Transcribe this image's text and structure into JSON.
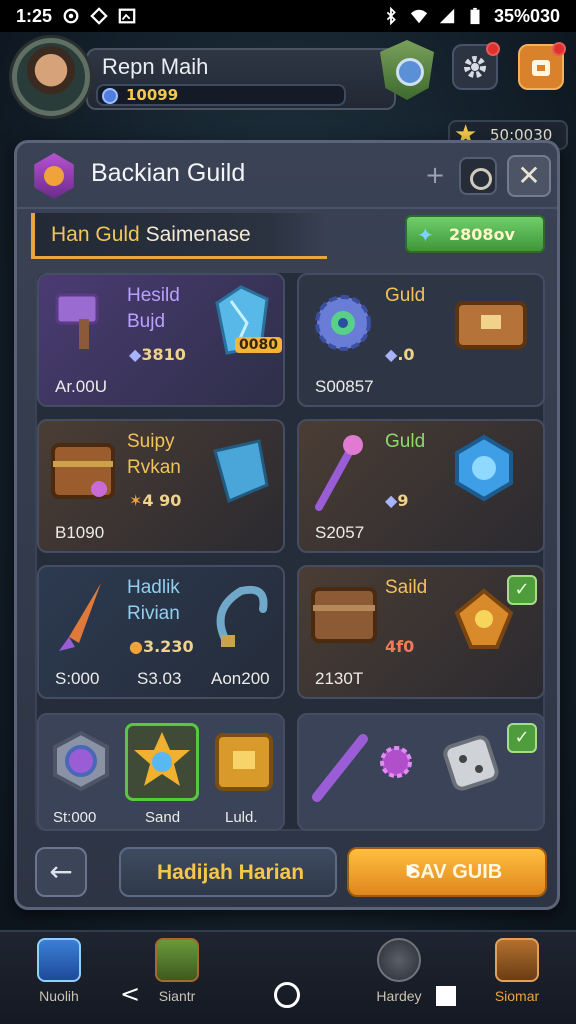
{
  "status_bar": {
    "time": "1:25",
    "battery": "35%030"
  },
  "header": {
    "player_name": "Repn Maih",
    "xp_value": "10099",
    "coin_value": "50:0030"
  },
  "modal": {
    "title": "Backian Guild",
    "subtitle_prefix": "Han Guld",
    "subtitle_rest": "Saimenase",
    "gold_value": "2808ov",
    "cards": [
      {
        "name1": "Hesild",
        "name2": "Bujd",
        "cost": "3810",
        "badge": "0080",
        "footer": "Ar.00U",
        "color": "#b9a1ff"
      },
      {
        "name1": "Guld",
        "name2": "",
        "cost": ".0",
        "badge": "",
        "footer": "S00857",
        "color": "#f1c25c"
      },
      {
        "name1": "Suipy",
        "name2": "Rvkan",
        "cost": "4 90",
        "badge": "",
        "footer": "B1090",
        "color": "#f1c25c"
      },
      {
        "name1": "Guld",
        "name2": "",
        "cost": "9",
        "badge": "",
        "footer": "S2057",
        "color": "#8cd96a"
      },
      {
        "name1": "Hadlik",
        "name2": "Rivian",
        "cost": "3.230",
        "badge": "",
        "footer": "S:000",
        "footer2": "S3.03",
        "footer3": "Aon200",
        "color": "#8fd0f0"
      },
      {
        "name1": "Saild",
        "name2": "",
        "cost": "4f0",
        "badge": "",
        "footer": "2130T",
        "color": "#f1c25c"
      }
    ],
    "row4_left_labels": [
      "St:000",
      "Sand",
      "Luld."
    ],
    "buttons": {
      "back": "←",
      "daily": "Hadijah Harian",
      "save": "SAV GUIB"
    }
  },
  "bottom_nav": [
    {
      "label": "Nuolih",
      "icon": "cube-icon"
    },
    {
      "label": "Siantr",
      "icon": "chest-icon"
    },
    {
      "label": "Hardey",
      "icon": "helmet-icon"
    },
    {
      "label": "Siomar",
      "icon": "treasure-icon"
    }
  ]
}
